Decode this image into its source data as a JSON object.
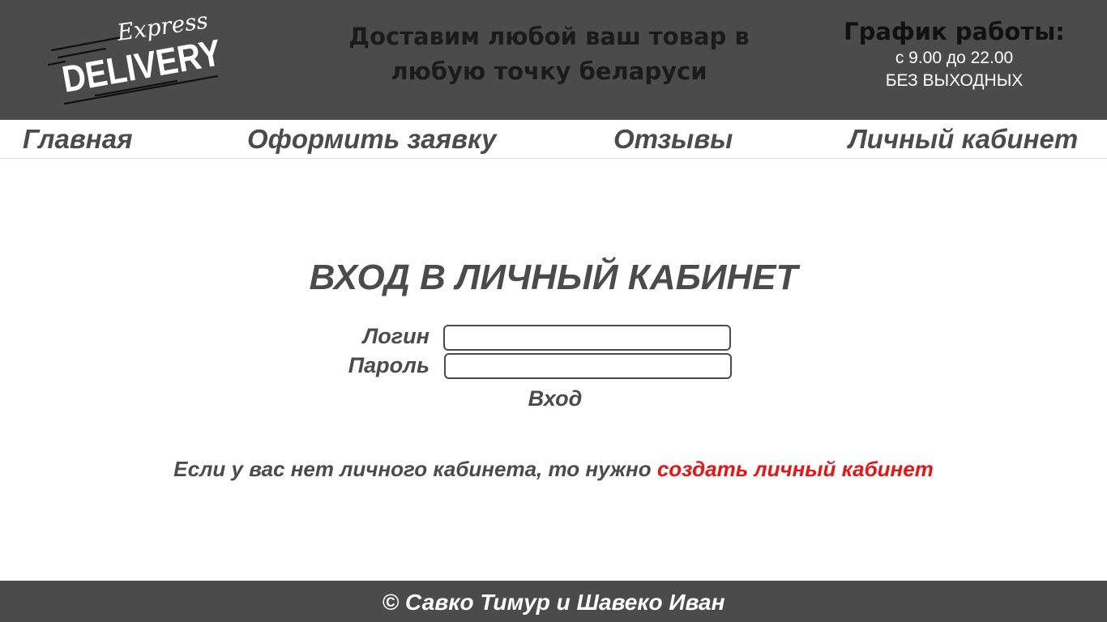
{
  "header": {
    "logo": {
      "top_text": "Express",
      "main_text": "DELIVERY",
      "icon": "express-delivery-logo"
    },
    "tagline_line1": "Доставим  любой ваш товар в",
    "tagline_line2": "любую точку беларуси",
    "schedule": {
      "title": "График работы:",
      "hours": "с 9.00 до 22.00",
      "days": "БЕЗ ВЫХОДНЫХ"
    }
  },
  "nav": {
    "items": [
      {
        "label": "Главная"
      },
      {
        "label": "Оформить заявку"
      },
      {
        "label": "Отзывы"
      },
      {
        "label": "Личный кабинет"
      }
    ]
  },
  "login": {
    "title": "ВХОД В ЛИЧНЫЙ КАБИНЕТ",
    "login_label": "Логин",
    "login_value": "",
    "password_label": "Пароль",
    "password_value": "",
    "submit_label": "Вход"
  },
  "register": {
    "prefix": "Если у вас нет личного кабинета, то нужно ",
    "link_text": "создать личный кабинет"
  },
  "footer": {
    "copyright": "© Савко Тимур и  Шавеко Иван"
  },
  "colors": {
    "header_bg": "#4b4b4b",
    "text_gray": "#4b4b4b",
    "link_red": "#ee1212",
    "background": "#ffffff"
  }
}
